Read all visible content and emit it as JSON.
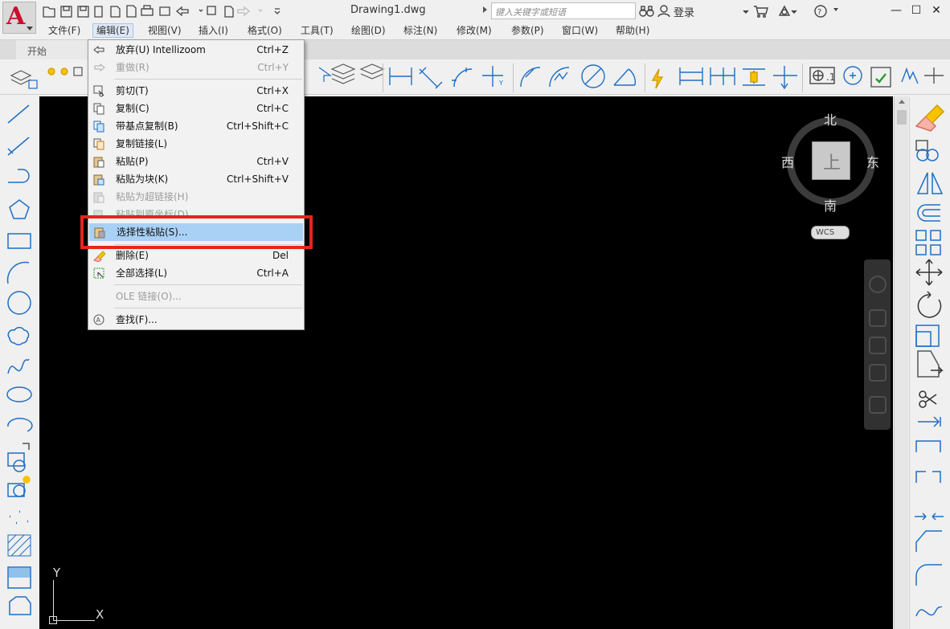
{
  "title_bar": {
    "document_name": "Drawing1.dwg",
    "search_placeholder": "键入关键字或短语",
    "login_label": "登录",
    "minimize": "—",
    "restore": "☐",
    "close": "✕"
  },
  "menubar": {
    "items": [
      "文件(F)",
      "编辑(E)",
      "视图(V)",
      "插入(I)",
      "格式(O)",
      "工具(T)",
      "绘图(D)",
      "标注(N)",
      "修改(M)",
      "参数(P)",
      "窗口(W)",
      "帮助(H)"
    ],
    "active_index": 1,
    "mdi_controls": [
      "—",
      "❐",
      "✕"
    ]
  },
  "tabs": {
    "start_tab": "开始"
  },
  "edit_menu": {
    "items": [
      {
        "label": "放弃(U) Intellizoom",
        "shortcut": "Ctrl+Z",
        "enabled": true,
        "icon": "undo-icon"
      },
      {
        "label": "重做(R)",
        "shortcut": "Ctrl+Y",
        "enabled": false,
        "icon": "redo-icon"
      },
      {
        "label": "剪切(T)",
        "shortcut": "Ctrl+X",
        "enabled": true,
        "icon": "cut-icon"
      },
      {
        "label": "复制(C)",
        "shortcut": "Ctrl+C",
        "enabled": true,
        "icon": "copy-icon"
      },
      {
        "label": "带基点复制(B)",
        "shortcut": "Ctrl+Shift+C",
        "enabled": true,
        "icon": "copy-basepoint-icon"
      },
      {
        "label": "复制链接(L)",
        "shortcut": "",
        "enabled": true,
        "icon": "copy-link-icon"
      },
      {
        "label": "粘贴(P)",
        "shortcut": "Ctrl+V",
        "enabled": true,
        "icon": "paste-icon"
      },
      {
        "label": "粘贴为块(K)",
        "shortcut": "Ctrl+Shift+V",
        "enabled": true,
        "icon": "paste-block-icon"
      },
      {
        "label": "粘贴为超链接(H)",
        "shortcut": "",
        "enabled": false,
        "icon": "paste-hyperlink-icon"
      },
      {
        "label": "粘贴到原坐标(D)",
        "shortcut": "",
        "enabled": false,
        "icon": "paste-orig-icon"
      },
      {
        "label": "选择性粘贴(S)...",
        "shortcut": "",
        "enabled": true,
        "icon": "paste-special-icon",
        "highlighted": true
      },
      {
        "label": "删除(E)",
        "shortcut": "Del",
        "enabled": true,
        "icon": "erase-icon"
      },
      {
        "label": "全部选择(L)",
        "shortcut": "Ctrl+A",
        "enabled": true,
        "icon": "select-all-icon"
      },
      {
        "label": "OLE 链接(O)...",
        "shortcut": "",
        "enabled": false,
        "icon": ""
      },
      {
        "label": "查找(F)...",
        "shortcut": "",
        "enabled": true,
        "icon": "find-icon"
      }
    ]
  },
  "viewcube": {
    "north": "北",
    "south": "南",
    "east": "东",
    "west": "西",
    "face": "上",
    "coord_system": "WCS"
  },
  "ucs": {
    "x_label": "X",
    "y_label": "Y"
  },
  "colors": {
    "canvas": "#000000",
    "highlight_row": "#a9d1f5",
    "annotation_box": "#e8241c",
    "brand_red": "#c8102e",
    "tool_blue": "#1f6fc4"
  }
}
